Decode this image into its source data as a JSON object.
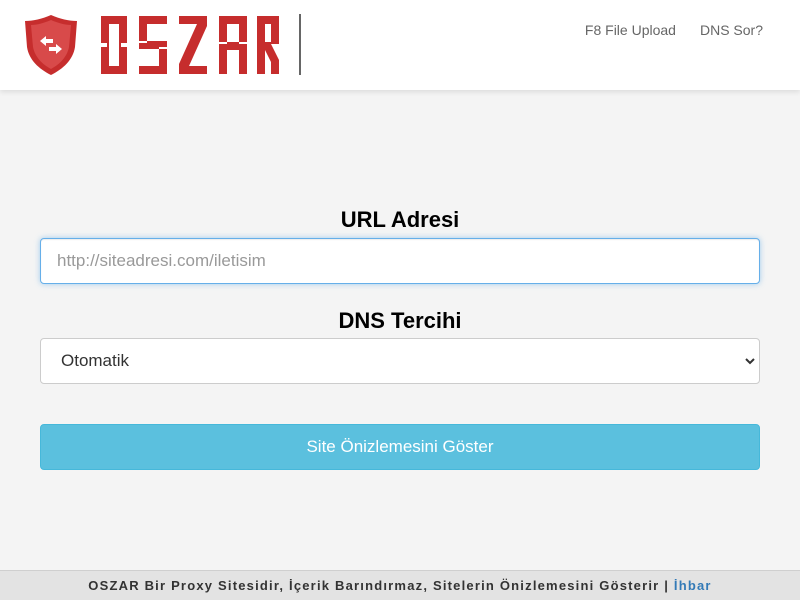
{
  "header": {
    "logo_text": "OSZAR",
    "nav": [
      {
        "label": "F8 File Upload"
      },
      {
        "label": "DNS Sor?"
      }
    ]
  },
  "form": {
    "url_label": "URL Adresi",
    "url_placeholder": "http://siteadresi.com/iletisim",
    "url_value": "",
    "dns_label": "DNS Tercihi",
    "dns_selected": "Otomatik",
    "submit_label": "Site Önizlemesini Göster"
  },
  "footer": {
    "text": "OSZAR Bir Proxy Sitesidir, İçerik Barındırmaz, Sitelerin Önizlemesini Gösterir",
    "separator": "|",
    "report_link": "İhbar"
  },
  "colors": {
    "brand_red": "#c62d2d",
    "button_info": "#5bc0de",
    "link_blue": "#337ab7"
  }
}
